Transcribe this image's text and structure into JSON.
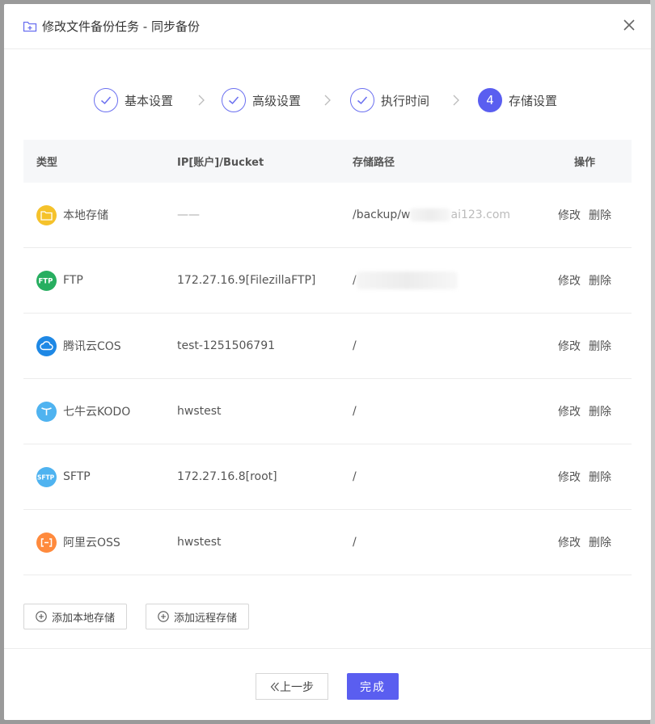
{
  "dialog": {
    "title": "修改文件备份任务 - 同步备份",
    "close_icon": "close-icon",
    "accent_color": "#5a5ef0"
  },
  "steps": [
    {
      "label": "基本设置",
      "state": "done",
      "icon": "check-icon"
    },
    {
      "label": "高级设置",
      "state": "done",
      "icon": "check-icon"
    },
    {
      "label": "执行时间",
      "state": "done",
      "icon": "check-icon"
    },
    {
      "label": "存储设置",
      "state": "active",
      "number": "4"
    }
  ],
  "table": {
    "headers": {
      "type": "类型",
      "ip": "IP[账户]/Bucket",
      "path": "存储路径",
      "ops": "操作"
    },
    "rows": [
      {
        "type": "本地存储",
        "icon": "folder-icon",
        "icon_color": "#f5c22b",
        "ip": "——",
        "path": "/backup/w",
        "path_tail": "ai123.com"
      },
      {
        "type": "FTP",
        "icon": "ftp-icon",
        "icon_color": "#27ae60",
        "ip": "172.27.16.9[FilezillaFTP]",
        "path": "/"
      },
      {
        "type": "腾讯云COS",
        "icon": "cloud-icon",
        "icon_color": "#1e88e5",
        "ip": "test-1251506791",
        "path": "/"
      },
      {
        "type": "七牛云KODO",
        "icon": "qiniu-icon",
        "icon_color": "#4fb3f0",
        "ip": "hwstest",
        "path": "/"
      },
      {
        "type": "SFTP",
        "icon": "sftp-icon",
        "icon_color": "#4fb3f0",
        "ip": "172.27.16.8[root]",
        "path": "/"
      },
      {
        "type": "阿里云OSS",
        "icon": "aliyun-icon",
        "icon_color": "#ff8a3d",
        "ip": "hwstest",
        "path": "/"
      }
    ],
    "edit_label": "修改",
    "delete_label": "删除"
  },
  "actions": {
    "add_local": "添加本地存储",
    "add_remote": "添加远程存储"
  },
  "footer": {
    "prev_label": "上一步",
    "done_label": "完成"
  }
}
